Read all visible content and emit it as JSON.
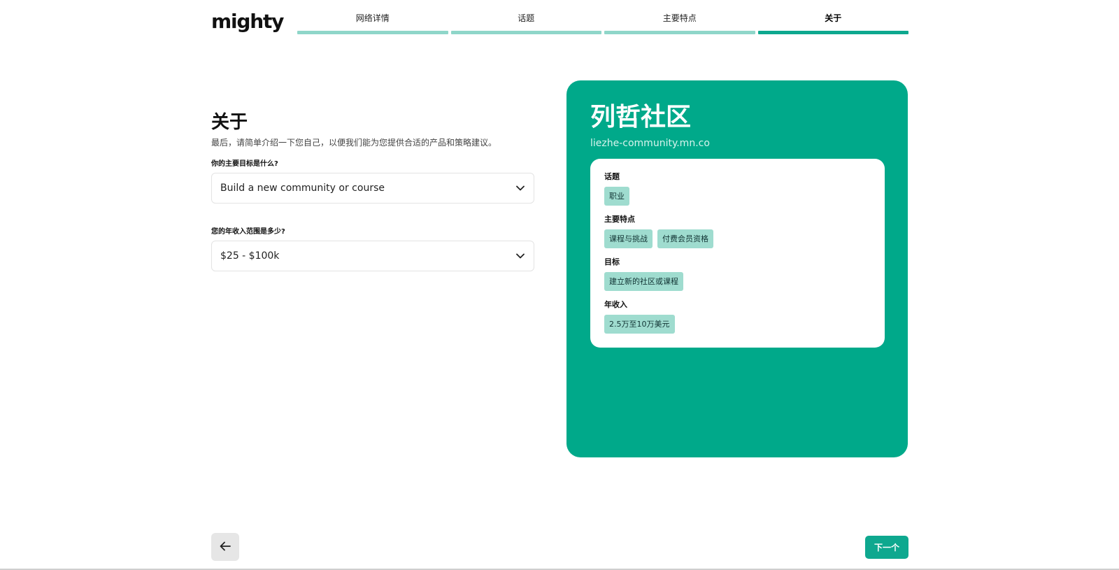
{
  "app": {
    "logo": "mighty"
  },
  "steps": [
    {
      "label": "网络详情",
      "active": false
    },
    {
      "label": "话题",
      "active": false
    },
    {
      "label": "主要特点",
      "active": false
    },
    {
      "label": "关于",
      "active": true
    }
  ],
  "form": {
    "title": "关于",
    "subtitle": "最后，请简单介绍一下您自己，以便我们能为您提供合适的产品和策略建议。",
    "goal": {
      "label": "你的主要目标是什么?",
      "value": "Build a new community or course"
    },
    "income": {
      "label": "您的年收入范围是多少?",
      "value": "$25 - $100k"
    }
  },
  "preview": {
    "name": "列哲社区",
    "url": "liezhe-community.mn.co",
    "sections": {
      "topics": {
        "title": "话题",
        "tags": [
          "职业"
        ]
      },
      "features": {
        "title": "主要特点",
        "tags": [
          "课程与挑战",
          "付费会员资格"
        ]
      },
      "goal": {
        "title": "目标",
        "tags": [
          "建立新的社区或课程"
        ]
      },
      "income": {
        "title": "年收入",
        "tags": [
          "2.5万至10万美元"
        ]
      }
    }
  },
  "nav": {
    "back_icon": "arrow-left-icon",
    "next_label": "下一个"
  },
  "colors": {
    "accent": "#0ea88f",
    "card_bg": "#00a98a",
    "step_done": "#8fd6c9",
    "tag_bg": "#9fdccf"
  }
}
